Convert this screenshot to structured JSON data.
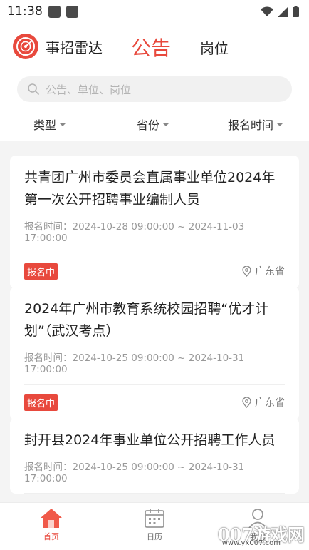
{
  "status_bar": {
    "time": "11:38"
  },
  "header": {
    "brand": "事招雷达",
    "tabs": [
      {
        "label": "公告",
        "active": true
      },
      {
        "label": "岗位",
        "active": false
      }
    ]
  },
  "search": {
    "placeholder": "公告、单位、岗位"
  },
  "filters": [
    "类型",
    "省份",
    "报名时间"
  ],
  "cards": [
    {
      "title": "共青团广州市委员会直属事业单位2024年第一次公开招聘事业编制人员",
      "time_label": "报名时间：",
      "time_range": "2024-10-28 09:00:00 ~ 2024-11-03 17:00:00",
      "status": "报名中",
      "location": "广东省"
    },
    {
      "title": "2024年广州市教育系统校园招聘“优才计划”（武汉考点）",
      "time_label": "报名时间：",
      "time_range": "2024-10-25 09:00:00 ~ 2024-10-31 17:00:00",
      "status": "报名中",
      "location": "广东省"
    },
    {
      "title": "封开县2024年事业单位公开招聘工作人员",
      "time_label": "报名时间：",
      "time_range": "2024-10-25 09:00:00 ~ 2024-10-31 17:00:00",
      "status": "",
      "location": ""
    }
  ],
  "bottom_nav": [
    {
      "label": "首页",
      "icon": "home-icon",
      "active": true
    },
    {
      "label": "日历",
      "icon": "calendar-icon",
      "active": false
    },
    {
      "label": "我的",
      "icon": "user-icon",
      "active": false
    }
  ],
  "watermark": {
    "text": "007游戏网",
    "url": "www.yx007.com"
  },
  "colors": {
    "accent": "#e8493d",
    "text": "#222222",
    "muted": "#999999",
    "background": "#f4f4f4"
  }
}
